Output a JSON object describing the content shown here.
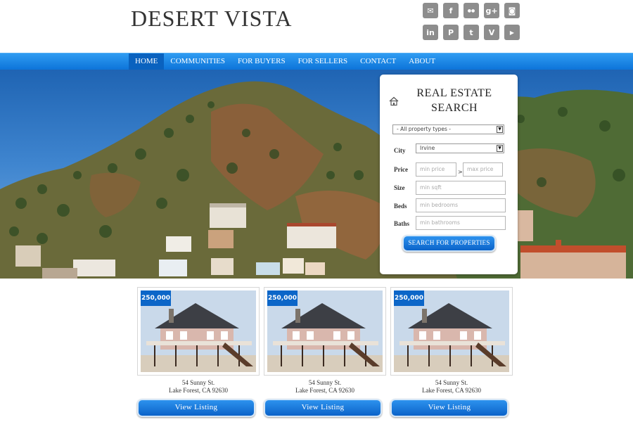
{
  "site": {
    "title": "DESERT VISTA"
  },
  "social": {
    "row1": [
      {
        "icon": "email-icon",
        "glyph": "✉"
      },
      {
        "icon": "facebook-icon",
        "glyph": "f"
      },
      {
        "icon": "flickr-icon",
        "glyph": "●●"
      },
      {
        "icon": "googleplus-icon",
        "glyph": "g+"
      },
      {
        "icon": "instagram-icon",
        "glyph": "◙"
      }
    ],
    "row2": [
      {
        "icon": "linkedin-icon",
        "glyph": "in"
      },
      {
        "icon": "pinterest-icon",
        "glyph": "P"
      },
      {
        "icon": "twitter-icon",
        "glyph": "t"
      },
      {
        "icon": "vimeo-icon",
        "glyph": "V"
      },
      {
        "icon": "youtube-icon",
        "glyph": "▶"
      }
    ]
  },
  "nav": {
    "items": [
      "HOME",
      "COMMUNITIES",
      "FOR BUYERS",
      "FOR SELLERS",
      "CONTACT",
      "ABOUT"
    ],
    "active": "HOME"
  },
  "search": {
    "title_line1": "REAL ESTATE",
    "title_line2": "SEARCH",
    "property_type": "- All property types -",
    "city_label": "City",
    "city_value": "Irvine",
    "price_label": "Price",
    "min_price_placeholder": "min price",
    "price_separator": ">",
    "max_price_placeholder": "max price",
    "size_label": "Size",
    "size_placeholder": "min sqft",
    "beds_label": "Beds",
    "beds_placeholder": "min bedrooms",
    "baths_label": "Baths",
    "baths_placeholder": "min bathrooms",
    "button_label": "Search for properties"
  },
  "listings": [
    {
      "price": "250,000",
      "street": "54 Sunny St.",
      "city": "Lake Forest, CA 92630",
      "button": "View Listing"
    },
    {
      "price": "250,000",
      "street": "54 Sunny St.",
      "city": "Lake Forest, CA 92630",
      "button": "View Listing"
    },
    {
      "price": "250,000",
      "street": "54 Sunny St.",
      "city": "Lake Forest, CA 92630",
      "button": "View Listing"
    }
  ],
  "colors": {
    "accent": "#0c66c8",
    "nav": "#1a86e6",
    "social": "#8d8d8d"
  }
}
